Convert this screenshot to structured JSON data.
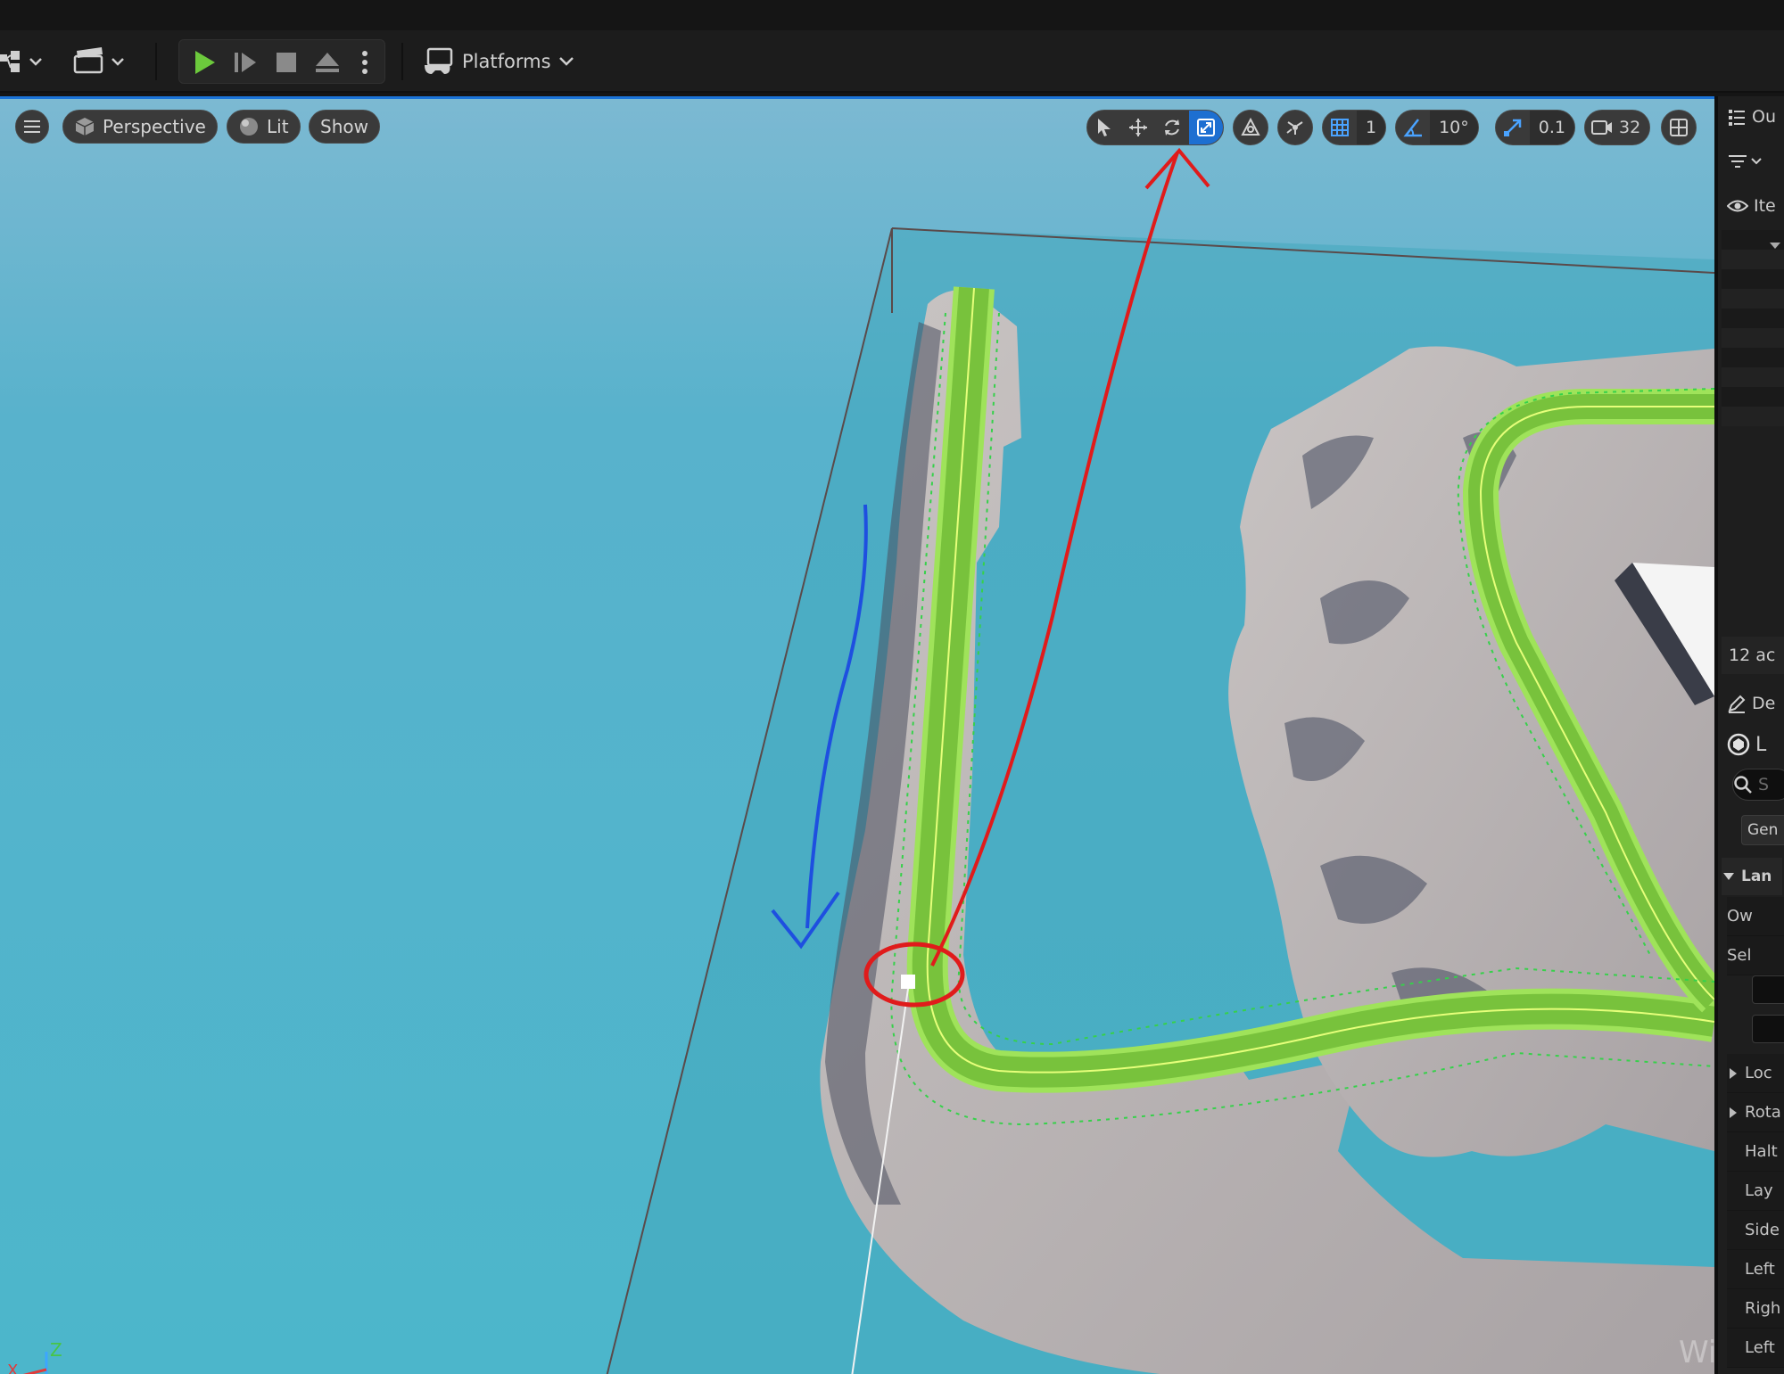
{
  "toolbar": {
    "platforms_label": "Platforms",
    "icons": [
      "mode-select-icon",
      "cinematics-icon",
      "play-icon",
      "advance-frame-icon",
      "stop-icon",
      "eject-icon",
      "more-options-icon",
      "platforms-icon"
    ]
  },
  "viewport": {
    "menu_icon": "hamburger-menu-icon",
    "perspective_label": "Perspective",
    "lit_label": "Lit",
    "show_label": "Show",
    "grid_snap_value": "1",
    "rotation_snap_value": "10°",
    "scale_snap_value": "0.1",
    "camera_speed_value": "32",
    "axis_labels": {
      "x": "X",
      "z": "Z"
    },
    "colors": {
      "water": "#4fb4c9",
      "road": "#7cc242",
      "road_edge": "#d9ff5a",
      "terrain": "#b8b2b0",
      "annotation_red": "#e01b1b",
      "annotation_blue": "#1e4fe0",
      "active_tool": "#1d6fd1"
    }
  },
  "outliner": {
    "tab_label": "Ou",
    "column_label": "Ite",
    "count_label": "12 ac"
  },
  "details": {
    "tab_label": "De",
    "actor_label": "L",
    "search_placeholder": "S",
    "general_button": "Gen",
    "section_label": "Lan",
    "fields": [
      "Ow",
      "Sel",
      "Loc",
      "Rota",
      "Halt",
      "Lay",
      "Side",
      "Left",
      "Righ",
      "Left"
    ]
  },
  "watermark": "Windo"
}
